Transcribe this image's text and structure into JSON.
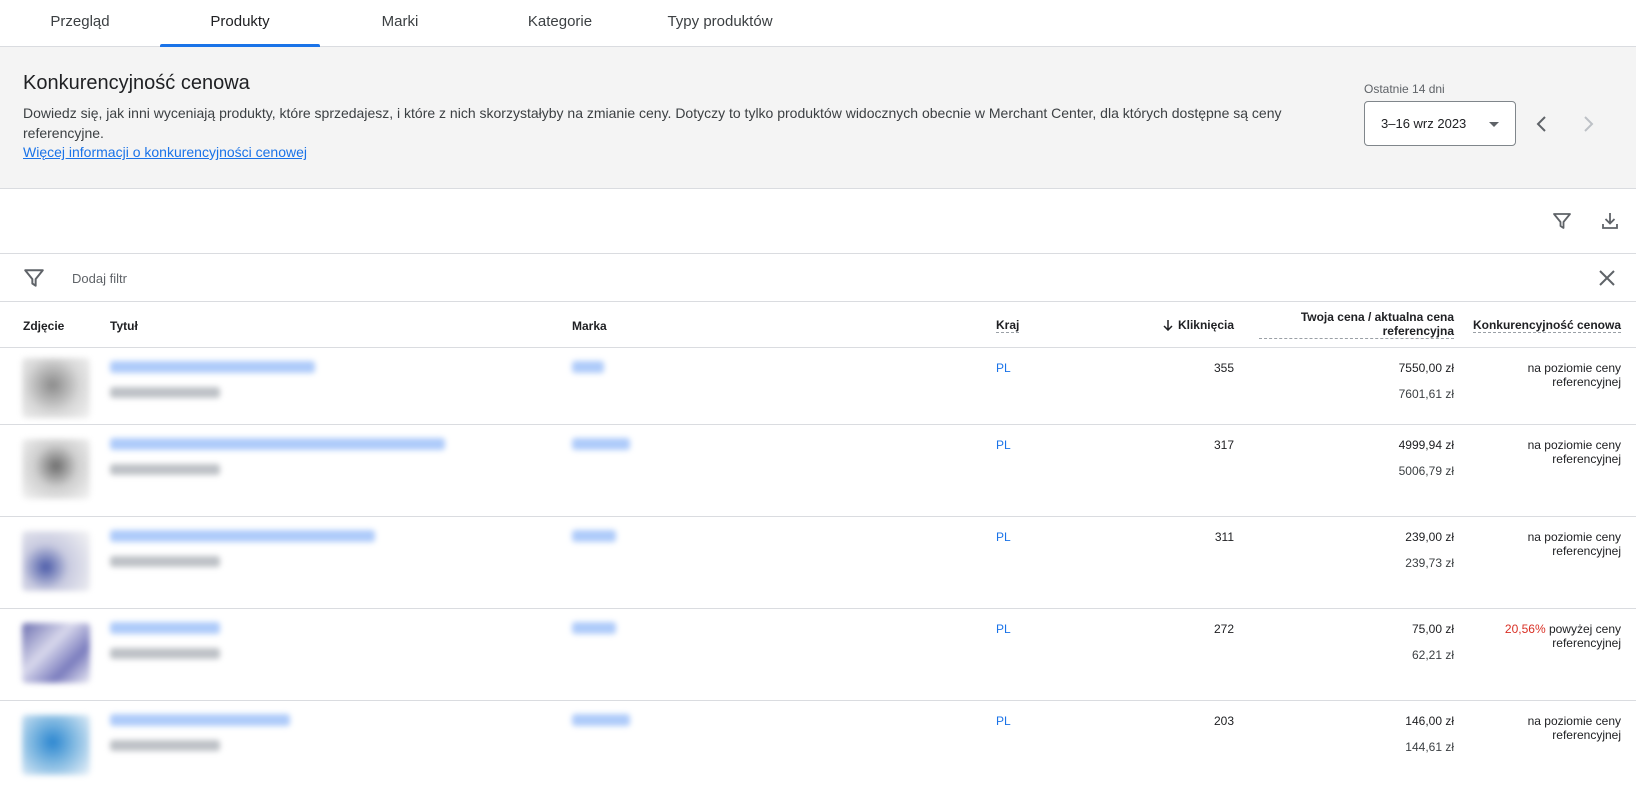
{
  "tabs": [
    "Przegląd",
    "Produkty",
    "Marki",
    "Kategorie",
    "Typy produktów"
  ],
  "banner": {
    "title": "Konkurencyjność cenowa",
    "description": "Dowiedz się, jak inni wyceniają produkty, które sprzedajesz, i które z nich skorzystałyby na zmianie ceny. Dotyczy to tylko produktów widocznych obecnie w Merchant Center, dla których dostępne są ceny referencyjne.",
    "link": "Więcej informacji o konkurencyjności cenowej",
    "period_label": "Ostatnie 14 dni",
    "date_range": "3–16 wrz 2023"
  },
  "filter": {
    "placeholder": "Dodaj filtr"
  },
  "table": {
    "headers": {
      "image": "Zdjęcie",
      "title": "Tytuł",
      "brand": "Marka",
      "country": "Kraj",
      "clicks": "Kliknięcia",
      "price_line1": "Twoja cena / aktualna cena",
      "price_line2": "referencyjna",
      "competitiveness": "Konkurencyjność cenowa"
    },
    "rows": [
      {
        "country": "PL",
        "clicks": "355",
        "price": "7550,00 zł",
        "ref_price": "7601,61 zł",
        "pct": "",
        "comp_line1": "na poziomie ceny",
        "comp_line2": "referencyjnej"
      },
      {
        "country": "PL",
        "clicks": "317",
        "price": "4999,94 zł",
        "ref_price": "5006,79 zł",
        "pct": "",
        "comp_line1": "na poziomie ceny",
        "comp_line2": "referencyjnej"
      },
      {
        "country": "PL",
        "clicks": "311",
        "price": "239,00 zł",
        "ref_price": "239,73 zł",
        "pct": "",
        "comp_line1": "na poziomie ceny",
        "comp_line2": "referencyjnej"
      },
      {
        "country": "PL",
        "clicks": "272",
        "price": "75,00 zł",
        "ref_price": "62,21 zł",
        "pct": "20,56%",
        "comp_line1": " powyżej ceny",
        "comp_line2": "referencyjnej"
      },
      {
        "country": "PL",
        "clicks": "203",
        "price": "146,00 zł",
        "ref_price": "144,61 zł",
        "pct": "",
        "comp_line1": "na poziomie ceny",
        "comp_line2": "referencyjnej"
      }
    ]
  },
  "colors": {
    "accent": "#1a73e8",
    "negative": "#d93025",
    "banner_bg": "#f4f4f4"
  }
}
